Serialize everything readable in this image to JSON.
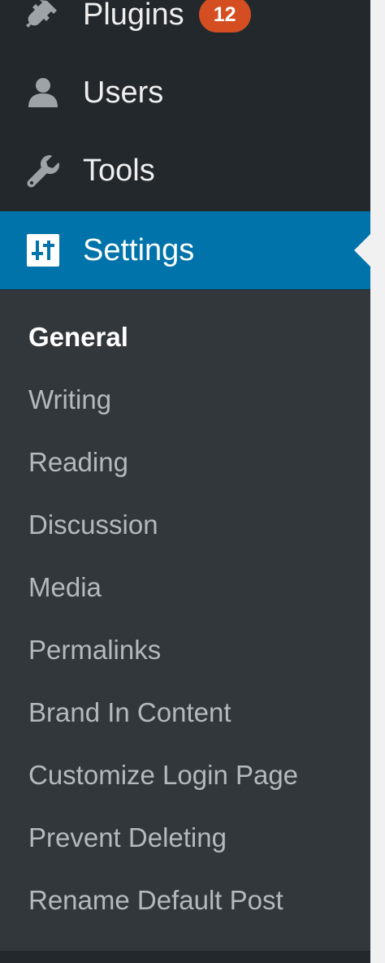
{
  "menu": {
    "items": [
      {
        "label": "Plugins",
        "icon": "plugin-icon",
        "badge": "12"
      },
      {
        "label": "Users",
        "icon": "user-icon"
      },
      {
        "label": "Tools",
        "icon": "wrench-icon"
      },
      {
        "label": "Settings",
        "icon": "settings-icon",
        "current": true
      }
    ]
  },
  "submenu": {
    "items": [
      {
        "label": "General",
        "active": true
      },
      {
        "label": "Writing"
      },
      {
        "label": "Reading"
      },
      {
        "label": "Discussion"
      },
      {
        "label": "Media"
      },
      {
        "label": "Permalinks"
      },
      {
        "label": "Brand In Content"
      },
      {
        "label": "Customize Login Page"
      },
      {
        "label": "Prevent Deleting"
      },
      {
        "label": "Rename Default Post"
      }
    ]
  },
  "colors": {
    "menu_background": "#23282d",
    "submenu_background": "#32373c",
    "current_item": "#0073aa",
    "badge": "#d54e21",
    "submenu_text": "#b4b9be",
    "icon": "#9ea3a8",
    "page_background": "#f1f1f1"
  }
}
